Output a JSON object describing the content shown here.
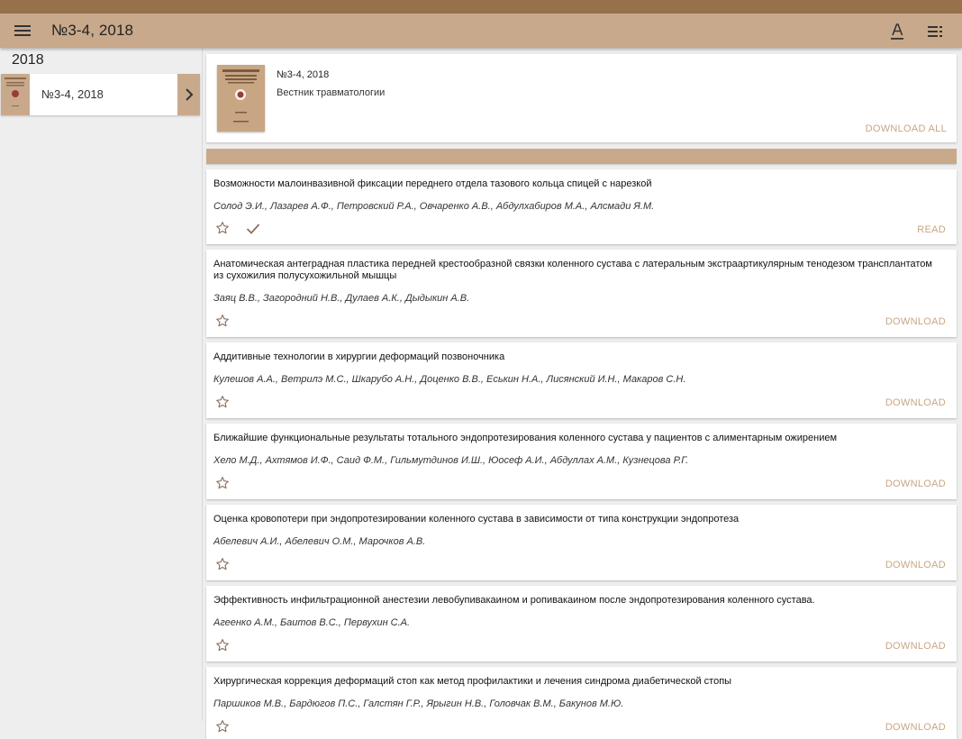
{
  "appbar": {
    "title": "№3-4, 2018",
    "icons": [
      "menu-icon",
      "text-format-icon",
      "list-icon"
    ]
  },
  "colors": {
    "statusbar": "#97714a",
    "appbar": "#c9a98b",
    "accent": "#c8a683"
  },
  "sidebar": {
    "year": "2018",
    "items": [
      {
        "label": "№3-4, 2018"
      }
    ]
  },
  "issue": {
    "title": "№3-4, 2018",
    "journal": "Вестник травматологии",
    "download_all": "DOWNLOAD ALL"
  },
  "articles": [
    {
      "title": "Возможности малоинвазивной фиксации переднего отдела тазового кольца спицей с нарезкой",
      "authors": "Солод Э.И., Лазарев А.Ф., Петровский Р.А., Овчаренко А.В., Абдулхабиров М.А., Алсмади Я.М.",
      "action": "READ",
      "downloaded": true
    },
    {
      "title": "Анатомическая антеградная пластика передней крестообразной связки коленного сустава с латеральным экстраартикулярным тенодезом трансплантатом из сухожилия полусухожильной мышцы",
      "authors": "Заяц В.В., Загородний Н.В., Дулаев А.К., Дыдыкин А.В.",
      "action": "DOWNLOAD",
      "downloaded": false
    },
    {
      "title": "Аддитивные технологии в хирургии деформаций позвоночника",
      "authors": "Кулешов А.А., Ветрилэ М.С., Шкарубо А.Н., Доценко В.В., Еськин Н.А., Лисянский И.Н., Макаров С.Н.",
      "action": "DOWNLOAD",
      "downloaded": false
    },
    {
      "title": "Ближайшие функциональные результаты тотального эндопротезирования коленного сустава у пациентов с алиментарным ожирением",
      "authors": "Хело М.Д., Ахтямов И.Ф., Саид Ф.М., Гильмутдинов И.Ш., Юосеф А.И., Абдуллах А.М., Кузнецова Р.Г.",
      "action": "DOWNLOAD",
      "downloaded": false
    },
    {
      "title": "Оценка кровопотери при эндопротезировании коленного сустава в зависимости от типа конструкции эндопротеза",
      "authors": "Абелевич А.И., Абелевич О.М., Марочков А.В.",
      "action": "DOWNLOAD",
      "downloaded": false
    },
    {
      "title": "Эффективность инфильтрационной анестезии левобупивакаином и ропивакаином после эндопротезирования коленного сустава.",
      "authors": "Агеенко А.М., Баитов В.С., Первухин С.А.",
      "action": "DOWNLOAD",
      "downloaded": false
    },
    {
      "title": "Хирургическая коррекция деформаций стоп как метод профилактики и лечения синдрома диабетической стопы",
      "authors": "Паршиков М.В., Бардюгов П.С., Галстян Г.Р., Ярыгин Н.В., Головчак В.М., Бакунов М.Ю.",
      "action": "DOWNLOAD",
      "downloaded": false
    }
  ]
}
